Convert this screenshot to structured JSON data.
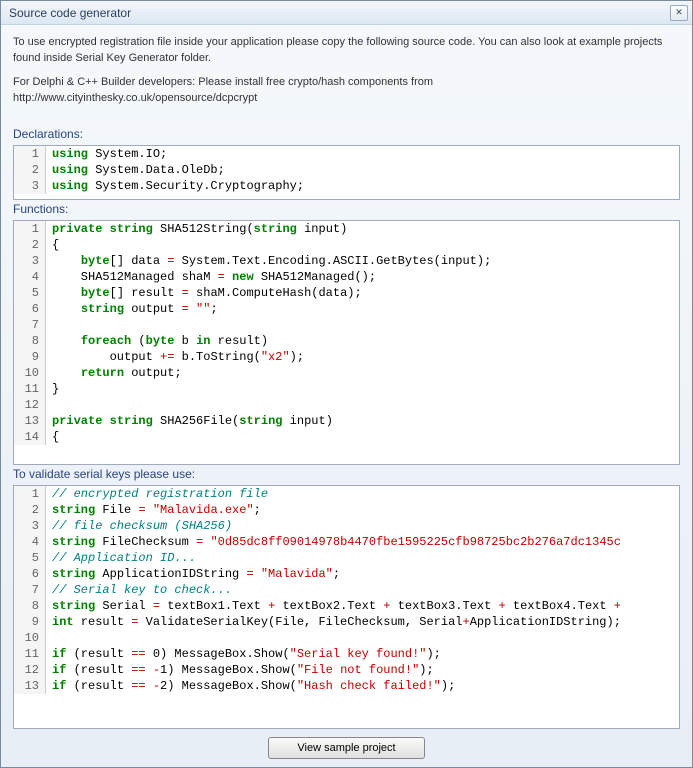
{
  "window": {
    "title": "Source code generator",
    "close": "✕"
  },
  "intro": {
    "p1": "To use encrypted registration file inside your application please copy the following source code. You can also look at example projects found inside Serial Key Generator folder.",
    "p2": "For Delphi & C++ Builder developers: Please install free crypto/hash components from http://www.cityinthesky.co.uk/opensource/dcpcrypt"
  },
  "sections": {
    "declarations": "Declarations:",
    "functions": "Functions:",
    "validation": "To validate serial keys please use:"
  },
  "declarations_code": [
    [
      {
        "t": "kw",
        "v": "using"
      },
      {
        "t": "",
        "v": " System.IO;"
      }
    ],
    [
      {
        "t": "kw",
        "v": "using"
      },
      {
        "t": "",
        "v": " System.Data.OleDb;"
      }
    ],
    [
      {
        "t": "kw",
        "v": "using"
      },
      {
        "t": "",
        "v": " System.Security.Cryptography;"
      }
    ]
  ],
  "functions_code": [
    [
      {
        "t": "kw",
        "v": "private"
      },
      {
        "t": "",
        "v": " "
      },
      {
        "t": "kw",
        "v": "string"
      },
      {
        "t": "",
        "v": " SHA512String("
      },
      {
        "t": "kw",
        "v": "string"
      },
      {
        "t": "",
        "v": " input)"
      }
    ],
    [
      {
        "t": "",
        "v": "{"
      }
    ],
    [
      {
        "t": "",
        "v": "    "
      },
      {
        "t": "kw",
        "v": "byte"
      },
      {
        "t": "",
        "v": "[] data "
      },
      {
        "t": "op",
        "v": "="
      },
      {
        "t": "",
        "v": " System.Text.Encoding.ASCII.GetBytes(input);"
      }
    ],
    [
      {
        "t": "",
        "v": "    SHA512Managed shaM "
      },
      {
        "t": "op",
        "v": "="
      },
      {
        "t": "",
        "v": " "
      },
      {
        "t": "kw",
        "v": "new"
      },
      {
        "t": "",
        "v": " SHA512Managed();"
      }
    ],
    [
      {
        "t": "",
        "v": "    "
      },
      {
        "t": "kw",
        "v": "byte"
      },
      {
        "t": "",
        "v": "[] result "
      },
      {
        "t": "op",
        "v": "="
      },
      {
        "t": "",
        "v": " shaM.ComputeHash(data);"
      }
    ],
    [
      {
        "t": "",
        "v": "    "
      },
      {
        "t": "kw",
        "v": "string"
      },
      {
        "t": "",
        "v": " output "
      },
      {
        "t": "op",
        "v": "="
      },
      {
        "t": "",
        "v": " "
      },
      {
        "t": "str",
        "v": "\"\""
      },
      {
        "t": "",
        "v": ";"
      }
    ],
    [
      {
        "t": "",
        "v": ""
      }
    ],
    [
      {
        "t": "",
        "v": "    "
      },
      {
        "t": "kw",
        "v": "foreach"
      },
      {
        "t": "",
        "v": " ("
      },
      {
        "t": "kw",
        "v": "byte"
      },
      {
        "t": "",
        "v": " b "
      },
      {
        "t": "kw",
        "v": "in"
      },
      {
        "t": "",
        "v": " result)"
      }
    ],
    [
      {
        "t": "",
        "v": "        output "
      },
      {
        "t": "op",
        "v": "+="
      },
      {
        "t": "",
        "v": " b.ToString("
      },
      {
        "t": "str",
        "v": "\"x2\""
      },
      {
        "t": "",
        "v": ");"
      }
    ],
    [
      {
        "t": "",
        "v": "    "
      },
      {
        "t": "kw",
        "v": "return"
      },
      {
        "t": "",
        "v": " output;"
      }
    ],
    [
      {
        "t": "",
        "v": "}"
      }
    ],
    [
      {
        "t": "",
        "v": ""
      }
    ],
    [
      {
        "t": "kw",
        "v": "private"
      },
      {
        "t": "",
        "v": " "
      },
      {
        "t": "kw",
        "v": "string"
      },
      {
        "t": "",
        "v": " SHA256File("
      },
      {
        "t": "kw",
        "v": "string"
      },
      {
        "t": "",
        "v": " input)"
      }
    ],
    [
      {
        "t": "",
        "v": "{"
      }
    ]
  ],
  "validation_code": [
    [
      {
        "t": "cmt",
        "v": "// encrypted registration file"
      }
    ],
    [
      {
        "t": "kw",
        "v": "string"
      },
      {
        "t": "",
        "v": " File "
      },
      {
        "t": "op",
        "v": "="
      },
      {
        "t": "",
        "v": " "
      },
      {
        "t": "str",
        "v": "\"Malavida.exe\""
      },
      {
        "t": "",
        "v": ";"
      }
    ],
    [
      {
        "t": "cmt",
        "v": "// file checksum (SHA256)"
      }
    ],
    [
      {
        "t": "kw",
        "v": "string"
      },
      {
        "t": "",
        "v": " FileChecksum "
      },
      {
        "t": "op",
        "v": "="
      },
      {
        "t": "",
        "v": " "
      },
      {
        "t": "str",
        "v": "\"0d85dc8ff09014978b4470fbe1595225cfb98725bc2b276a7dc1345c"
      }
    ],
    [
      {
        "t": "cmt",
        "v": "// Application ID..."
      }
    ],
    [
      {
        "t": "kw",
        "v": "string"
      },
      {
        "t": "",
        "v": " ApplicationIDString "
      },
      {
        "t": "op",
        "v": "="
      },
      {
        "t": "",
        "v": " "
      },
      {
        "t": "str",
        "v": "\"Malavida\""
      },
      {
        "t": "",
        "v": ";"
      }
    ],
    [
      {
        "t": "cmt",
        "v": "// Serial key to check..."
      }
    ],
    [
      {
        "t": "kw",
        "v": "string"
      },
      {
        "t": "",
        "v": " Serial "
      },
      {
        "t": "op",
        "v": "="
      },
      {
        "t": "",
        "v": " textBox1.Text "
      },
      {
        "t": "op",
        "v": "+"
      },
      {
        "t": "",
        "v": " textBox2.Text "
      },
      {
        "t": "op",
        "v": "+"
      },
      {
        "t": "",
        "v": " textBox3.Text "
      },
      {
        "t": "op",
        "v": "+"
      },
      {
        "t": "",
        "v": " textBox4.Text "
      },
      {
        "t": "op",
        "v": "+"
      }
    ],
    [
      {
        "t": "kw",
        "v": "int"
      },
      {
        "t": "",
        "v": " result "
      },
      {
        "t": "op",
        "v": "="
      },
      {
        "t": "",
        "v": " ValidateSerialKey(File, FileChecksum, Serial"
      },
      {
        "t": "op",
        "v": "+"
      },
      {
        "t": "",
        "v": "ApplicationIDString);"
      }
    ],
    [
      {
        "t": "",
        "v": ""
      }
    ],
    [
      {
        "t": "kw",
        "v": "if"
      },
      {
        "t": "",
        "v": " (result "
      },
      {
        "t": "op",
        "v": "=="
      },
      {
        "t": "",
        "v": " 0) MessageBox.Show("
      },
      {
        "t": "str",
        "v": "\"Serial key found!\""
      },
      {
        "t": "",
        "v": ");"
      }
    ],
    [
      {
        "t": "kw",
        "v": "if"
      },
      {
        "t": "",
        "v": " (result "
      },
      {
        "t": "op",
        "v": "=="
      },
      {
        "t": "",
        "v": " "
      },
      {
        "t": "op",
        "v": "-"
      },
      {
        "t": "",
        "v": "1) MessageBox.Show("
      },
      {
        "t": "str",
        "v": "\"File not found!\""
      },
      {
        "t": "",
        "v": ");"
      }
    ],
    [
      {
        "t": "kw",
        "v": "if"
      },
      {
        "t": "",
        "v": " (result "
      },
      {
        "t": "op",
        "v": "=="
      },
      {
        "t": "",
        "v": " "
      },
      {
        "t": "op",
        "v": "-"
      },
      {
        "t": "",
        "v": "2) MessageBox.Show("
      },
      {
        "t": "str",
        "v": "\"Hash check failed!\""
      },
      {
        "t": "",
        "v": ");"
      }
    ]
  ],
  "footer": {
    "sample_button": "View sample project"
  }
}
